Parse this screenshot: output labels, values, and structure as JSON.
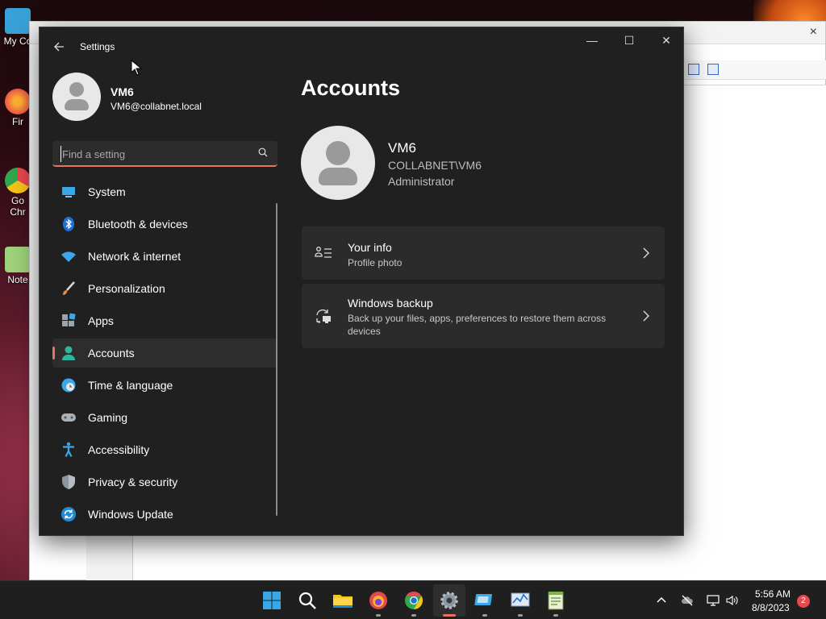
{
  "desktop": {
    "icons": [
      {
        "label": "My Co"
      },
      {
        "label": "Fir"
      },
      {
        "label": "Go\nChr"
      },
      {
        "label": "Note"
      }
    ]
  },
  "background_window": {
    "close_glyph": "×"
  },
  "settings": {
    "app_title": "Settings",
    "window_controls": {
      "minimize": "—",
      "maximize": "☐",
      "close": "✕"
    },
    "profile": {
      "name": "VM6",
      "email": "VM6@collabnet.local"
    },
    "search": {
      "placeholder": "Find a setting",
      "value": ""
    },
    "nav": [
      {
        "label": "System",
        "icon": "system-icon"
      },
      {
        "label": "Bluetooth & devices",
        "icon": "bluetooth-icon"
      },
      {
        "label": "Network & internet",
        "icon": "wifi-icon"
      },
      {
        "label": "Personalization",
        "icon": "brush-icon"
      },
      {
        "label": "Apps",
        "icon": "apps-icon"
      },
      {
        "label": "Accounts",
        "icon": "accounts-icon",
        "selected": true
      },
      {
        "label": "Time & language",
        "icon": "globe-clock-icon"
      },
      {
        "label": "Gaming",
        "icon": "gamepad-icon"
      },
      {
        "label": "Accessibility",
        "icon": "accessibility-icon"
      },
      {
        "label": "Privacy & security",
        "icon": "shield-icon"
      },
      {
        "label": "Windows Update",
        "icon": "update-icon"
      }
    ],
    "page_title": "Accounts",
    "account": {
      "name": "VM6",
      "domain": "COLLABNET\\VM6",
      "role": "Administrator"
    },
    "cards": [
      {
        "title": "Your info",
        "subtitle": "Profile photo",
        "icon": "your-info-icon"
      },
      {
        "title": "Windows backup",
        "subtitle": "Back up your files, apps, preferences to restore them across devices",
        "icon": "backup-icon"
      }
    ],
    "colors": {
      "accent": "#e57461",
      "window_bg": "#202020",
      "card_bg": "#2b2b2b"
    }
  },
  "taskbar": {
    "apps": [
      "start-icon",
      "search-icon",
      "file-explorer-icon",
      "firefox-icon",
      "chrome-icon",
      "settings-icon",
      "remote-desktop-icon",
      "task-manager-icon",
      "notepad-icon"
    ],
    "active_app": "settings-icon",
    "clock": {
      "time": "5:56 AM",
      "date": "8/8/2023"
    },
    "notification_count": "2"
  }
}
